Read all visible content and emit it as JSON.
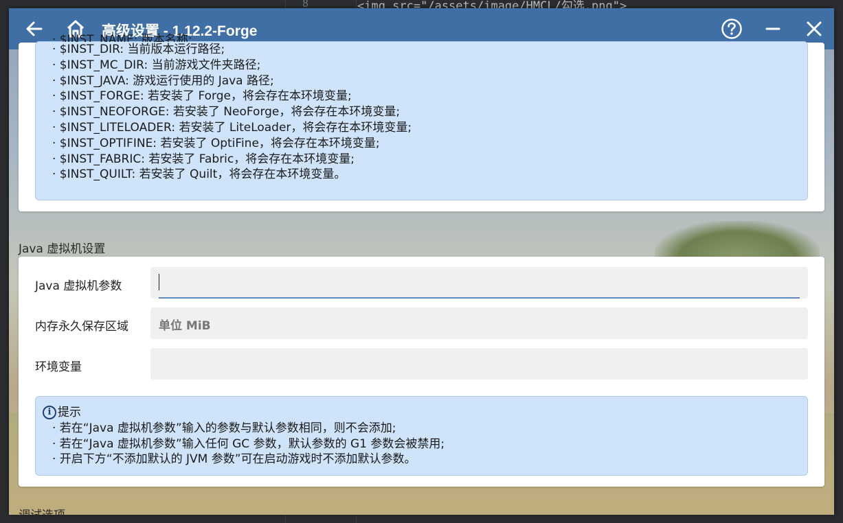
{
  "background": {
    "line_number": "8",
    "code_text": "<img src=\"/assets/image/HMCL/勾选.png\">"
  },
  "titlebar": {
    "title": "高级设置 - 1.12.2-Forge",
    "back_icon": "arrow-left-icon",
    "home_icon": "home-icon",
    "help_icon": "help-circle-icon",
    "minimize_icon": "minimize-icon",
    "close_icon": "close-icon",
    "color": "#3f6fa5"
  },
  "env_hint": {
    "lines": [
      "· $INST_DIR: 当前版本运行路径;",
      "· $INST_MC_DIR: 当前游戏文件夹路径;",
      "· $INST_JAVA: 游戏运行使用的 Java 路径;",
      "· $INST_FORGE: 若安装了 Forge，将会存在本环境变量;",
      "· $INST_NEOFORGE: 若安装了 NeoForge，将会存在本环境变量;",
      "· $INST_LITELOADER: 若安装了 LiteLoader，将会存在本环境变量;",
      "· $INST_OPTIFINE: 若安装了 OptiFine，将会存在本环境变量;",
      "· $INST_FABRIC: 若安装了 Fabric，将会存在本环境变量;",
      "· $INST_QUILT: 若安装了 Quilt，将会存在本环境变量。"
    ]
  },
  "jvm_section": {
    "title": "Java 虚拟机设置",
    "fields": [
      {
        "label": "Java 虚拟机参数",
        "value": "",
        "placeholder": ""
      },
      {
        "label": "内存永久保存区域",
        "value": "",
        "placeholder": "单位 MiB"
      },
      {
        "label": "环境变量",
        "value": "",
        "placeholder": ""
      }
    ],
    "hint": {
      "icon": "info-icon",
      "title": "提示",
      "lines": [
        "· 若在“Java 虚拟机参数”输入的参数与默认参数相同，则不会添加;",
        "· 若在“Java 虚拟机参数”输入任何 GC 参数，默认参数的 G1 参数会被禁用;",
        "· 开启下方“不添加默认的 JVM 参数”可在启动游戏时不添加默认参数。"
      ]
    }
  },
  "debug_section": {
    "title": "调试选项"
  }
}
